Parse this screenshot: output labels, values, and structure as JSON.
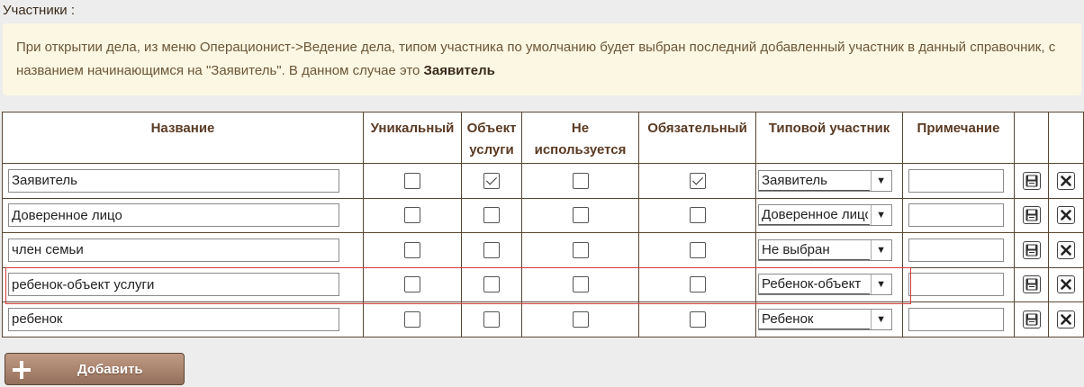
{
  "section_label": "Участники :",
  "notice": {
    "text": "При открытии дела, из меню Операционист->Ведение дела, типом участника по умолчанию будет выбран последний добавленный участник в данный справочник, с названием начинающимся на \"Заявитель\". В данном случае это ",
    "bold": "Заявитель"
  },
  "table": {
    "headers": {
      "name": "Название",
      "unique": "Уникальный",
      "service_object_1": "Объект",
      "service_object_2": "услуги",
      "not_used_1": "Не",
      "not_used_2": "используется",
      "required": "Обязательный",
      "typical": "Типовой участник",
      "note": "Примечание"
    },
    "rows": [
      {
        "name": "Заявитель",
        "unique": false,
        "service_object": true,
        "not_used": false,
        "required": true,
        "typical": "Заявитель",
        "note": ""
      },
      {
        "name": "Доверенное лицо",
        "unique": false,
        "service_object": false,
        "not_used": false,
        "required": false,
        "typical": "Доверенное лицо",
        "note": ""
      },
      {
        "name": "член семьи",
        "unique": false,
        "service_object": false,
        "not_used": false,
        "required": false,
        "typical": "Не выбран",
        "note": ""
      },
      {
        "name": "ребенок-объект услуги",
        "unique": false,
        "service_object": false,
        "not_used": false,
        "required": false,
        "typical": "Ребенок-объект",
        "note": ""
      },
      {
        "name": "ребенок",
        "unique": false,
        "service_object": false,
        "not_used": false,
        "required": false,
        "typical": "Ребенок",
        "note": ""
      }
    ]
  },
  "icons": {
    "save": "save-icon",
    "delete": "close-icon",
    "dropdown": "chevron-down-icon",
    "add": "plus-icon"
  },
  "highlight_color": "#d63a3a",
  "add_button": {
    "label": "Добавить"
  }
}
